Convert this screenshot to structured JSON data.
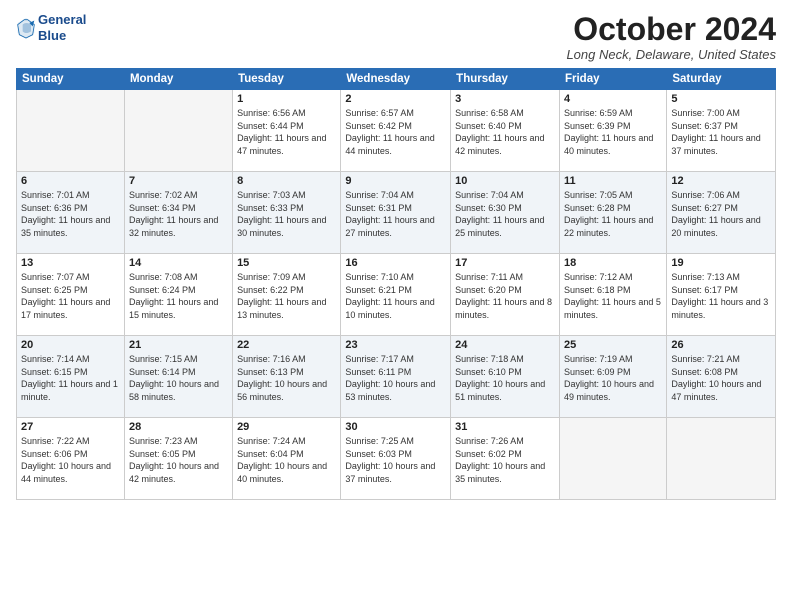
{
  "header": {
    "logo_line1": "General",
    "logo_line2": "Blue",
    "month_title": "October 2024",
    "location": "Long Neck, Delaware, United States"
  },
  "weekdays": [
    "Sunday",
    "Monday",
    "Tuesday",
    "Wednesday",
    "Thursday",
    "Friday",
    "Saturday"
  ],
  "weeks": [
    [
      {
        "day": "",
        "detail": ""
      },
      {
        "day": "",
        "detail": ""
      },
      {
        "day": "1",
        "detail": "Sunrise: 6:56 AM\nSunset: 6:44 PM\nDaylight: 11 hours and 47 minutes."
      },
      {
        "day": "2",
        "detail": "Sunrise: 6:57 AM\nSunset: 6:42 PM\nDaylight: 11 hours and 44 minutes."
      },
      {
        "day": "3",
        "detail": "Sunrise: 6:58 AM\nSunset: 6:40 PM\nDaylight: 11 hours and 42 minutes."
      },
      {
        "day": "4",
        "detail": "Sunrise: 6:59 AM\nSunset: 6:39 PM\nDaylight: 11 hours and 40 minutes."
      },
      {
        "day": "5",
        "detail": "Sunrise: 7:00 AM\nSunset: 6:37 PM\nDaylight: 11 hours and 37 minutes."
      }
    ],
    [
      {
        "day": "6",
        "detail": "Sunrise: 7:01 AM\nSunset: 6:36 PM\nDaylight: 11 hours and 35 minutes."
      },
      {
        "day": "7",
        "detail": "Sunrise: 7:02 AM\nSunset: 6:34 PM\nDaylight: 11 hours and 32 minutes."
      },
      {
        "day": "8",
        "detail": "Sunrise: 7:03 AM\nSunset: 6:33 PM\nDaylight: 11 hours and 30 minutes."
      },
      {
        "day": "9",
        "detail": "Sunrise: 7:04 AM\nSunset: 6:31 PM\nDaylight: 11 hours and 27 minutes."
      },
      {
        "day": "10",
        "detail": "Sunrise: 7:04 AM\nSunset: 6:30 PM\nDaylight: 11 hours and 25 minutes."
      },
      {
        "day": "11",
        "detail": "Sunrise: 7:05 AM\nSunset: 6:28 PM\nDaylight: 11 hours and 22 minutes."
      },
      {
        "day": "12",
        "detail": "Sunrise: 7:06 AM\nSunset: 6:27 PM\nDaylight: 11 hours and 20 minutes."
      }
    ],
    [
      {
        "day": "13",
        "detail": "Sunrise: 7:07 AM\nSunset: 6:25 PM\nDaylight: 11 hours and 17 minutes."
      },
      {
        "day": "14",
        "detail": "Sunrise: 7:08 AM\nSunset: 6:24 PM\nDaylight: 11 hours and 15 minutes."
      },
      {
        "day": "15",
        "detail": "Sunrise: 7:09 AM\nSunset: 6:22 PM\nDaylight: 11 hours and 13 minutes."
      },
      {
        "day": "16",
        "detail": "Sunrise: 7:10 AM\nSunset: 6:21 PM\nDaylight: 11 hours and 10 minutes."
      },
      {
        "day": "17",
        "detail": "Sunrise: 7:11 AM\nSunset: 6:20 PM\nDaylight: 11 hours and 8 minutes."
      },
      {
        "day": "18",
        "detail": "Sunrise: 7:12 AM\nSunset: 6:18 PM\nDaylight: 11 hours and 5 minutes."
      },
      {
        "day": "19",
        "detail": "Sunrise: 7:13 AM\nSunset: 6:17 PM\nDaylight: 11 hours and 3 minutes."
      }
    ],
    [
      {
        "day": "20",
        "detail": "Sunrise: 7:14 AM\nSunset: 6:15 PM\nDaylight: 11 hours and 1 minute."
      },
      {
        "day": "21",
        "detail": "Sunrise: 7:15 AM\nSunset: 6:14 PM\nDaylight: 10 hours and 58 minutes."
      },
      {
        "day": "22",
        "detail": "Sunrise: 7:16 AM\nSunset: 6:13 PM\nDaylight: 10 hours and 56 minutes."
      },
      {
        "day": "23",
        "detail": "Sunrise: 7:17 AM\nSunset: 6:11 PM\nDaylight: 10 hours and 53 minutes."
      },
      {
        "day": "24",
        "detail": "Sunrise: 7:18 AM\nSunset: 6:10 PM\nDaylight: 10 hours and 51 minutes."
      },
      {
        "day": "25",
        "detail": "Sunrise: 7:19 AM\nSunset: 6:09 PM\nDaylight: 10 hours and 49 minutes."
      },
      {
        "day": "26",
        "detail": "Sunrise: 7:21 AM\nSunset: 6:08 PM\nDaylight: 10 hours and 47 minutes."
      }
    ],
    [
      {
        "day": "27",
        "detail": "Sunrise: 7:22 AM\nSunset: 6:06 PM\nDaylight: 10 hours and 44 minutes."
      },
      {
        "day": "28",
        "detail": "Sunrise: 7:23 AM\nSunset: 6:05 PM\nDaylight: 10 hours and 42 minutes."
      },
      {
        "day": "29",
        "detail": "Sunrise: 7:24 AM\nSunset: 6:04 PM\nDaylight: 10 hours and 40 minutes."
      },
      {
        "day": "30",
        "detail": "Sunrise: 7:25 AM\nSunset: 6:03 PM\nDaylight: 10 hours and 37 minutes."
      },
      {
        "day": "31",
        "detail": "Sunrise: 7:26 AM\nSunset: 6:02 PM\nDaylight: 10 hours and 35 minutes."
      },
      {
        "day": "",
        "detail": ""
      },
      {
        "day": "",
        "detail": ""
      }
    ]
  ]
}
